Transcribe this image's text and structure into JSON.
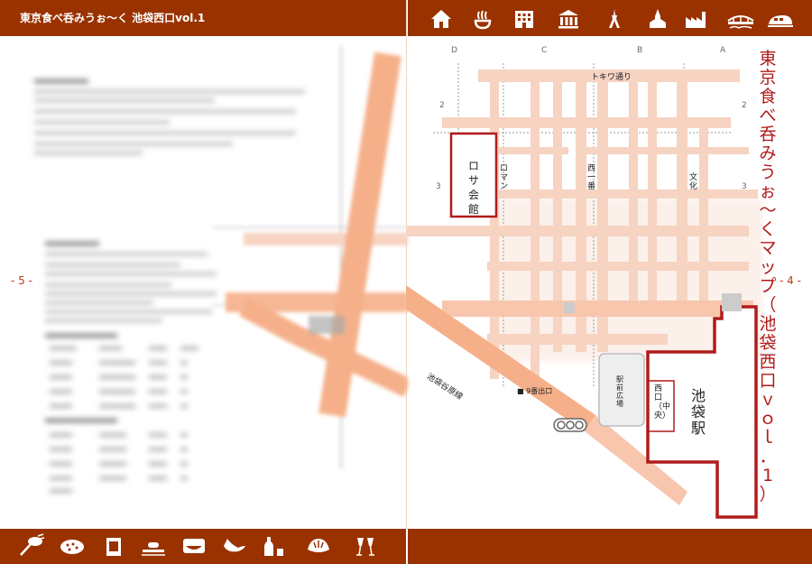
{
  "header": {
    "title": "東京食べ呑みうぉ〜く 池袋西口vol.1",
    "icons": [
      "house-icon",
      "hotspring-icon",
      "building-icon",
      "museum-icon",
      "tower-icon",
      "church-icon",
      "factory-icon",
      "bridge-icon",
      "train-icon"
    ]
  },
  "pages": {
    "left": "- 5 -",
    "right": "- 4 -"
  },
  "map": {
    "vertical_title": [
      "東",
      "京",
      "食",
      "べ",
      "呑",
      "み",
      "う",
      "ぉ",
      "〜",
      "く",
      "マ",
      "ッ",
      "プ",
      "（",
      "池",
      "袋",
      "西",
      "口",
      "ｖ",
      "ｏ",
      "ｌ",
      "．",
      "1",
      "）"
    ],
    "grid_cols": [
      "D",
      "C",
      "B",
      "A"
    ],
    "grid_rows": [
      "2",
      "3",
      "2",
      "3"
    ],
    "labels": {
      "tokiwa": "トキワ通り",
      "rosa": "ロサ会館",
      "roman": "ロマン",
      "nishi_ichiban": "西一番",
      "bunka": "文化",
      "ikebukuro_station": "池袋駅",
      "nishiguchi": "西口（中央）",
      "ekimae": "駅前広場",
      "exit9": "■ 9番出口",
      "line": "池袋谷原線"
    }
  },
  "footer": {
    "icons": [
      "noodle-icon",
      "pizza-icon",
      "beer-mug-icon",
      "sushi-icon",
      "bento-icon",
      "fish-icon",
      "sake-icon",
      "dumpling-icon",
      "toast-icon"
    ]
  },
  "colors": {
    "bar": "#9a3200",
    "accent": "#b11b1b",
    "road": "#f7d3c2",
    "mainroad": "#f5b08a"
  }
}
